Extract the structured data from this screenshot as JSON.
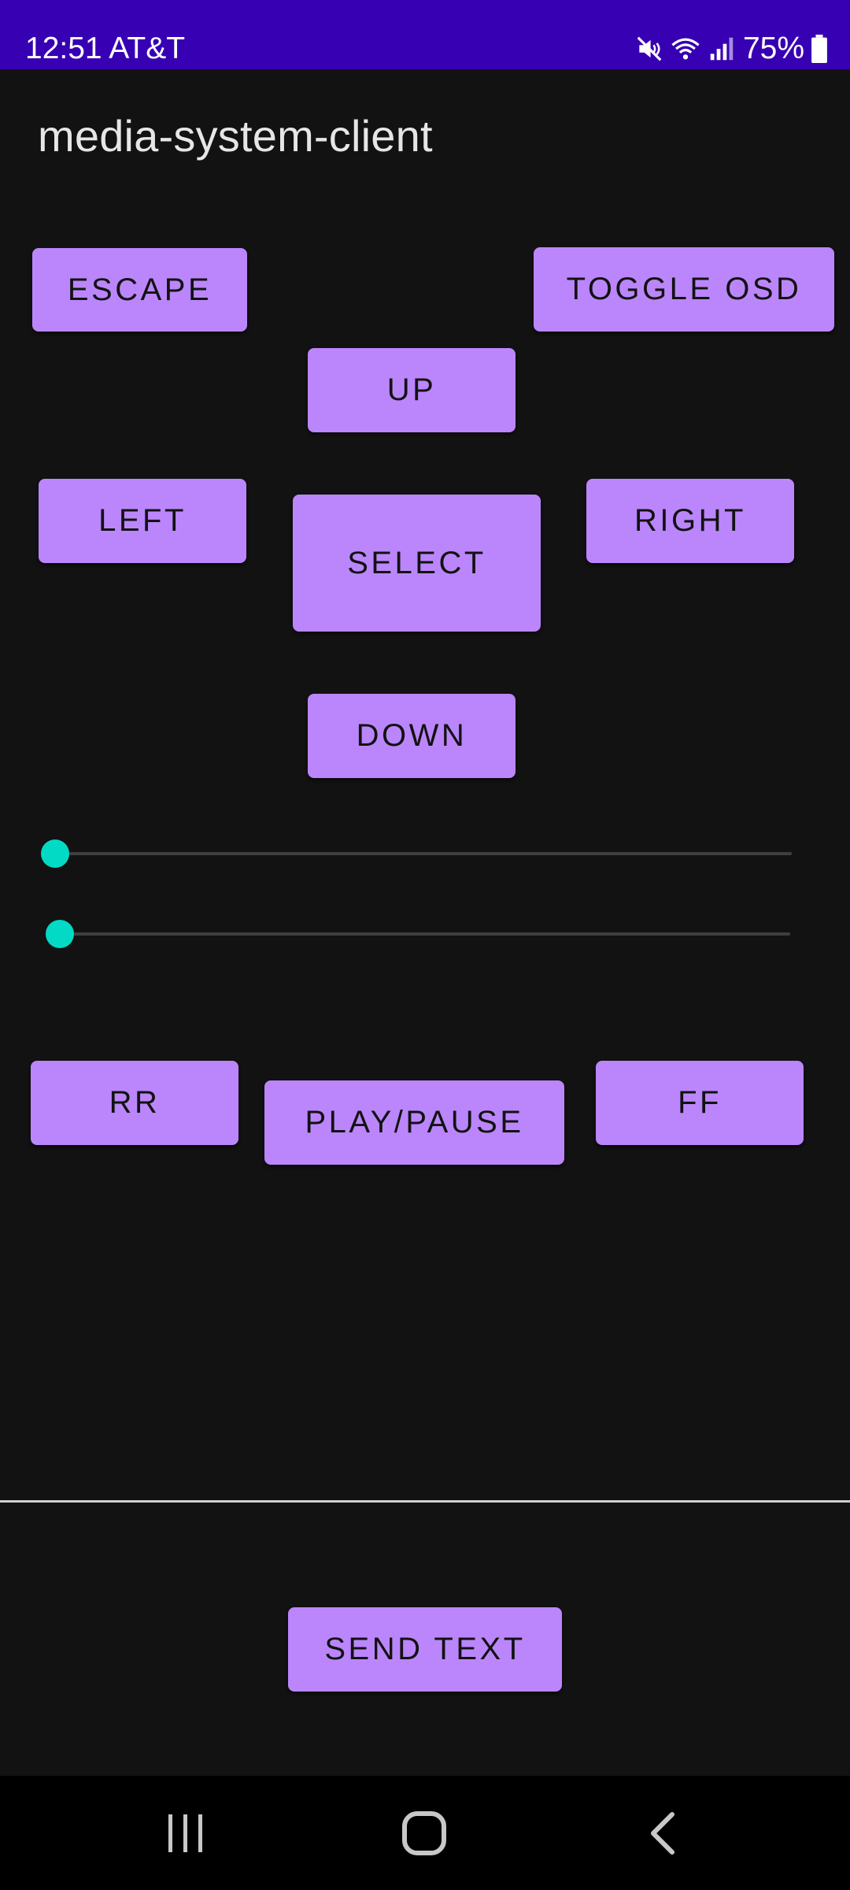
{
  "status_bar": {
    "time_carrier": "12:51 AT&T",
    "battery_percent": "75%",
    "icons": [
      "mute-vibrate-icon",
      "wifi-icon",
      "cell-signal-icon",
      "battery-icon"
    ]
  },
  "app": {
    "title": "media-system-client"
  },
  "controls": {
    "escape": "ESCAPE",
    "toggle_osd": "TOGGLE OSD",
    "up": "UP",
    "left": "LEFT",
    "select": "SELECT",
    "right": "RIGHT",
    "down": "DOWN",
    "rr": "RR",
    "play_pause": "PLAY/PAUSE",
    "ff": "FF",
    "send_text": "SEND TEXT"
  },
  "sliders": [
    {
      "value_fraction": 0.0
    },
    {
      "value_fraction": 0.0
    }
  ],
  "colors": {
    "status_bar": "#3700b3",
    "background": "#121212",
    "button": "#bb86fc",
    "button_text": "#121212",
    "slider_thumb": "#03dac5",
    "slider_track": "#3f3f3f"
  },
  "nav_bar": {
    "icons": [
      "recent-apps-icon",
      "home-icon",
      "back-icon"
    ]
  }
}
